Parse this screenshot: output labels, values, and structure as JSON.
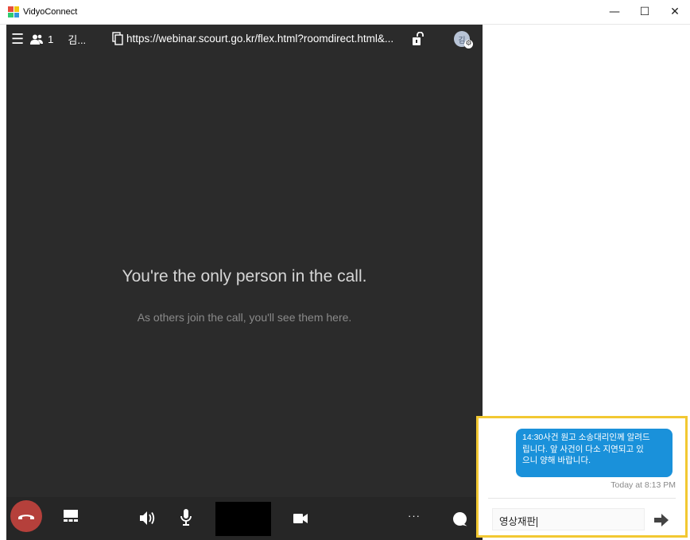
{
  "window": {
    "title": "VidyoConnect",
    "minimize_glyph": "—",
    "maximize_glyph": "☐",
    "close_glyph": "✕",
    "logo_icon": "vidyo-logo-icon"
  },
  "topbar": {
    "menu_glyph": "☰",
    "participant_count": "1",
    "user_short": "김...",
    "url": "https://webinar.scourt.go.kr/flex.html?roomdirect.html&...",
    "avatar_initial": "김",
    "icons": [
      "menu-icon",
      "participants-icon",
      "copy-icon",
      "lock-open-icon",
      "avatar",
      "gear-icon"
    ]
  },
  "call": {
    "empty_message": "You're the only person in the call.",
    "empty_sub": "As others join the call, you'll see them here."
  },
  "controls": {
    "more_glyph": "···",
    "icons": [
      "hangup-icon",
      "layout-icon",
      "speaker-icon",
      "microphone-icon",
      "camera-icon",
      "more-icon",
      "chat-icon"
    ]
  },
  "chat": {
    "message": {
      "lines": [
        "14:30사건 원고 소송대리인께 알려드",
        "립니다. 앞 사건이 다소 지연되고 있",
        "으니 양해 바랍니다."
      ],
      "time": "Today at 8:13 PM"
    },
    "input_value": "영상재판",
    "send_icon": "send-arrow-icon"
  },
  "colors": {
    "video_bg": "#2b2b2b",
    "controls_bg": "#262626",
    "hangup": "#b5403b",
    "bubble": "#1a91da",
    "highlight": "#f2c832"
  }
}
